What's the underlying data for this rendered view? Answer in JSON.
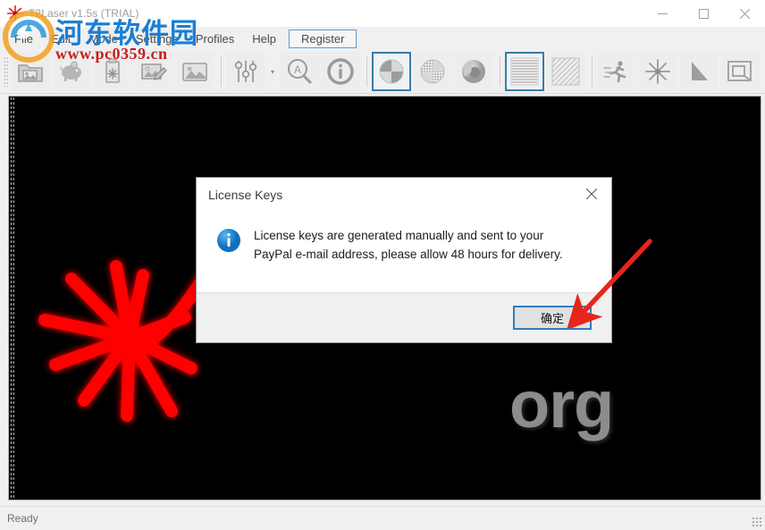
{
  "window": {
    "title": "T2Laser v1.5s (TRIAL)",
    "app_icon": "laser-burst-icon",
    "controls": {
      "minimize": "—",
      "maximize": "□",
      "close": "✕"
    }
  },
  "menubar": {
    "items": [
      {
        "label": "File",
        "name": "menu-file",
        "boxed": false
      },
      {
        "label": "Edit",
        "name": "menu-edit",
        "boxed": false
      },
      {
        "label": "Mode",
        "name": "menu-mode",
        "boxed": false
      },
      {
        "label": "Settings",
        "name": "menu-settings",
        "boxed": false
      },
      {
        "label": "Profiles",
        "name": "menu-profiles",
        "boxed": false
      },
      {
        "label": "Help",
        "name": "menu-help",
        "boxed": false
      },
      {
        "label": "Register",
        "name": "menu-register",
        "boxed": true
      }
    ]
  },
  "toolbar": {
    "buttons": [
      {
        "icon": "open-image-icon",
        "tooltip": "Open Image",
        "checked": false
      },
      {
        "icon": "piggy-bank-icon",
        "tooltip": "Save",
        "checked": false
      },
      {
        "icon": "usb-drive-icon",
        "tooltip": "USB Device",
        "checked": false
      },
      {
        "icon": "edit-image-icon",
        "tooltip": "Edit Image",
        "checked": false
      },
      {
        "icon": "picture-icon",
        "tooltip": "Picture",
        "checked": false
      },
      {
        "icon": "sliders-icon",
        "tooltip": "Adjustments",
        "checked": false
      },
      {
        "icon": "magnifier-a-icon",
        "tooltip": "Trace",
        "checked": false
      },
      {
        "icon": "info-circle-icon",
        "tooltip": "Information",
        "checked": false
      },
      {
        "icon": "pie-quarters-icon",
        "tooltip": "Threshold",
        "checked": true
      },
      {
        "icon": "pie-dither-icon",
        "tooltip": "Dither",
        "checked": false
      },
      {
        "icon": "sphere-icon",
        "tooltip": "Grayscale",
        "checked": false
      },
      {
        "icon": "horizontal-lines-icon",
        "tooltip": "Horizontal Scan",
        "checked": true
      },
      {
        "icon": "diagonal-hatch-icon",
        "tooltip": "Diagonal Scan",
        "checked": false
      },
      {
        "icon": "runner-icon",
        "tooltip": "Run",
        "checked": false
      },
      {
        "icon": "laser-burst-icon",
        "tooltip": "Laser",
        "checked": false
      },
      {
        "icon": "triangle-icon",
        "tooltip": "Vector",
        "checked": false
      },
      {
        "icon": "frame-icon",
        "tooltip": "Frame",
        "checked": false
      }
    ],
    "dropdown_caret": "▾"
  },
  "canvas": {
    "background_color": "#000000",
    "graphic": "red-laser-starburst",
    "graphic_color": "#ff0000",
    "background_text": "org"
  },
  "dialog": {
    "title": "License Keys",
    "close_label": "✕",
    "icon": "info-circle-icon",
    "message": "License keys are generated manually and sent to your PayPal e-mail address, please allow 48 hours for delivery.",
    "ok_label": "确定",
    "accent_color": "#2f7cbf",
    "info_icon_color": "#1a85d6"
  },
  "annotation": {
    "arrow": "red-arrow-pointing-to-ok-button",
    "color": "#e8251b"
  },
  "statusbar": {
    "text": "Ready"
  },
  "watermark": {
    "site_name": "河东软件园",
    "url": "www.pc0359.cn",
    "logo": "site-logo-icon",
    "site_color": "#1a7fd4",
    "url_color": "#c81e1e"
  }
}
